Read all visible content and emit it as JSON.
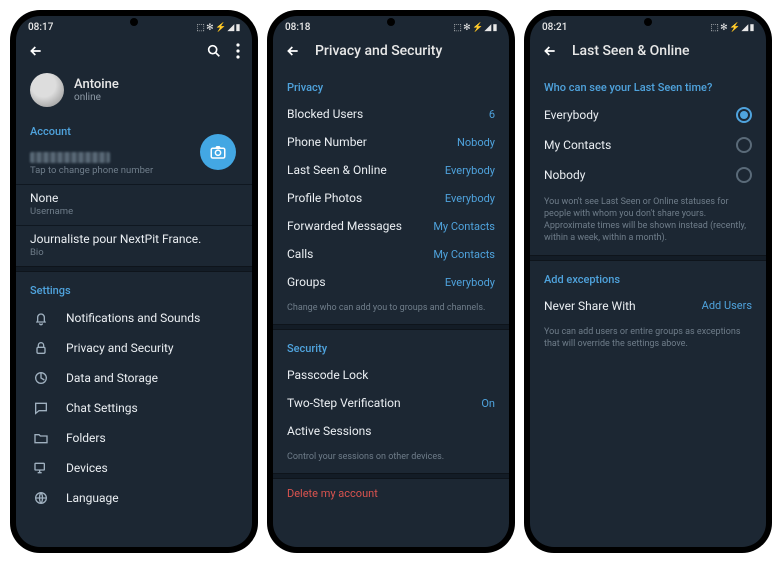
{
  "screen1": {
    "time": "08:17",
    "status_icons": "⬚ ✻ ⚡ ◢ ▮",
    "name": "Antoine",
    "status": "online",
    "account_header": "Account",
    "phone_tap": "Tap to change phone number",
    "username_value": "None",
    "username_sub": "Username",
    "bio_value": "Journaliste pour NextPit France.",
    "bio_sub": "Bio",
    "settings_header": "Settings",
    "items": [
      "Notifications and Sounds",
      "Privacy and Security",
      "Data and Storage",
      "Chat Settings",
      "Folders",
      "Devices",
      "Language"
    ]
  },
  "screen2": {
    "time": "08:18",
    "status_icons": "⬚ ✻ ⚡ ◢ ▮",
    "title": "Privacy and Security",
    "privacy_header": "Privacy",
    "privacy_rows": [
      {
        "label": "Blocked Users",
        "value": "6"
      },
      {
        "label": "Phone Number",
        "value": "Nobody"
      },
      {
        "label": "Last Seen & Online",
        "value": "Everybody"
      },
      {
        "label": "Profile Photos",
        "value": "Everybody"
      },
      {
        "label": "Forwarded Messages",
        "value": "My Contacts"
      },
      {
        "label": "Calls",
        "value": "My Contacts"
      },
      {
        "label": "Groups",
        "value": "Everybody"
      }
    ],
    "privacy_hint": "Change who can add you to groups and channels.",
    "security_header": "Security",
    "security_rows": [
      {
        "label": "Passcode Lock",
        "value": ""
      },
      {
        "label": "Two-Step Verification",
        "value": "On"
      },
      {
        "label": "Active Sessions",
        "value": ""
      }
    ],
    "security_hint": "Control your sessions on other devices.",
    "delete": "Delete my account"
  },
  "screen3": {
    "time": "08:21",
    "status_icons": "⬚ ✻ ⚡ ◢ ▮",
    "title": "Last Seen & Online",
    "q": "Who can see your Last Seen time?",
    "options": [
      "Everybody",
      "My Contacts",
      "Nobody"
    ],
    "selected": 0,
    "hint1": "You won't see Last Seen or Online statuses for people with whom you don't share yours. Approximate times will be shown instead (recently, within a week, within a month).",
    "exceptions_header": "Add exceptions",
    "exc_label": "Never Share With",
    "exc_value": "Add Users",
    "hint2": "You can add users or entire groups as exceptions that will override the settings above."
  }
}
